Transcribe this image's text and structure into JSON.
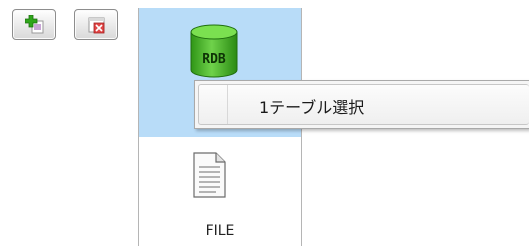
{
  "toolbar": {
    "add_icon": "add-plus-icon",
    "delete_icon": "delete-x-icon"
  },
  "panel": {
    "rdb_icon_text": "RDB",
    "file_label": "FILE"
  },
  "context_menu": {
    "items": [
      {
        "label": "1テーブル選択"
      }
    ]
  },
  "colors": {
    "selection": "#b8dcf8",
    "rdb_green": "#3fb51d",
    "add_green": "#2fa61a",
    "delete_red": "#d83434"
  }
}
